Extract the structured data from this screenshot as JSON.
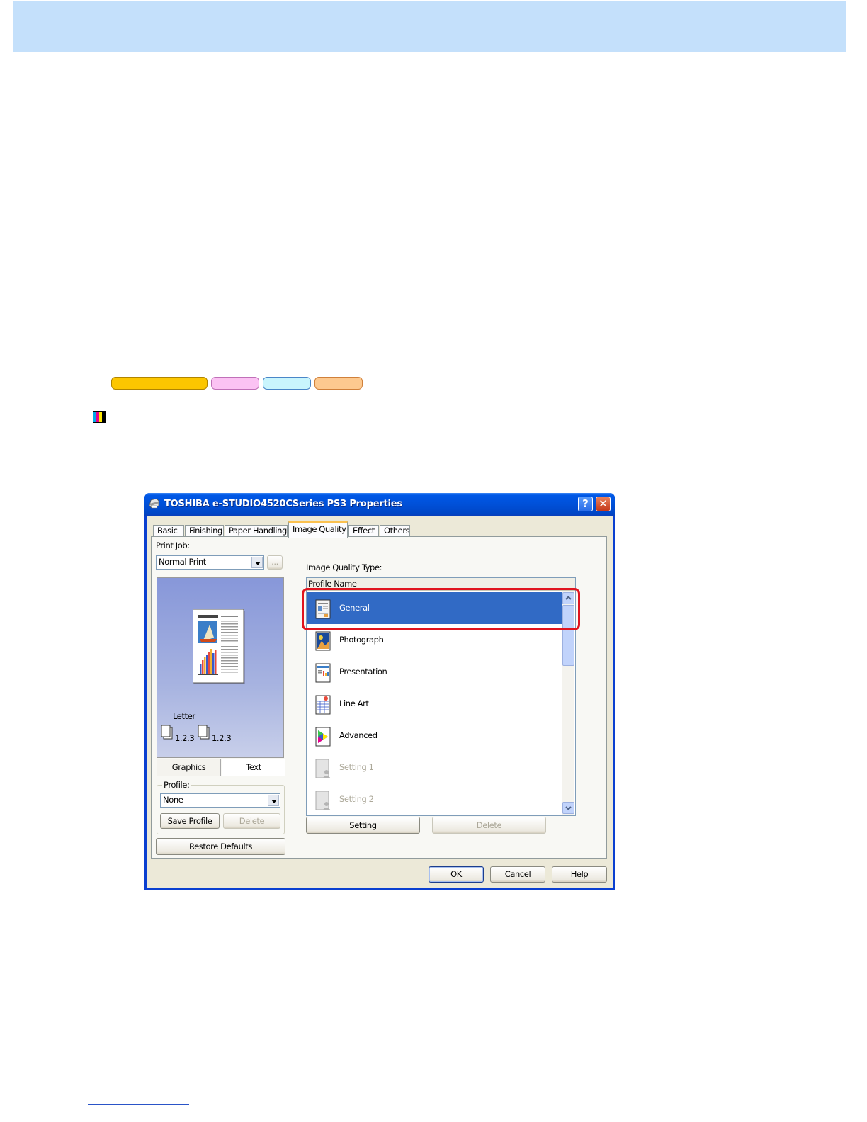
{
  "dialog": {
    "title": "TOSHIBA e-STUDIO4520CSeries PS3 Properties",
    "help_btn": "?",
    "close_btn": "✕"
  },
  "tabs": [
    {
      "label": "Basic"
    },
    {
      "label": "Finishing"
    },
    {
      "label": "Paper Handling"
    },
    {
      "label": "Image Quality",
      "active": true
    },
    {
      "label": "Effect"
    },
    {
      "label": "Others"
    }
  ],
  "left": {
    "print_job_label": "Print Job:",
    "print_job_value": "Normal Print",
    "ellipsis_btn": "...",
    "paper_label": "Letter",
    "collate_1": "1.2.3",
    "collate_2": "1.2.3",
    "graphics_tab": "Graphics",
    "text_tab": "Text",
    "profile_label": "Profile:",
    "profile_value": "None",
    "save_profile_btn": "Save Profile",
    "delete_btn": "Delete",
    "restore_defaults_btn": "Restore Defaults"
  },
  "right": {
    "iq_type_label": "Image Quality Type:",
    "list_header": "Profile Name",
    "items": [
      {
        "label": "General",
        "icon": "general-doc-icon",
        "selected": true
      },
      {
        "label": "Photograph",
        "icon": "photograph-icon"
      },
      {
        "label": "Presentation",
        "icon": "presentation-icon"
      },
      {
        "label": "Line Art",
        "icon": "line-art-icon"
      },
      {
        "label": "Advanced",
        "icon": "advanced-color-icon"
      },
      {
        "label": "Setting 1",
        "icon": "user-setting-icon",
        "disabled": true
      },
      {
        "label": "Setting 2",
        "icon": "user-setting-icon",
        "disabled": true
      }
    ],
    "setting_btn": "Setting",
    "delete_btn": "Delete"
  },
  "footer": {
    "ok": "OK",
    "cancel": "Cancel",
    "help": "Help"
  },
  "colors": {
    "header_band": "#c4e0fb",
    "selection": "#316ac5",
    "highlight_frame": "#e0141e",
    "tag_1": "#fcc600",
    "tag_2": "#fbc2f3",
    "tag_3": "#c9f5fd",
    "tag_4": "#fdc98f"
  }
}
